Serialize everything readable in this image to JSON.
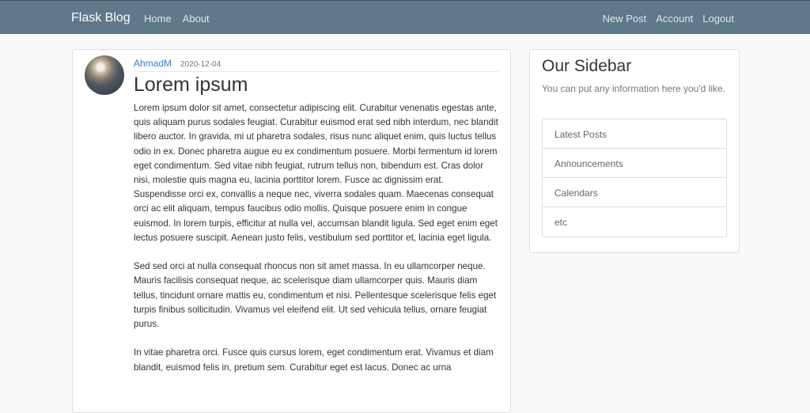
{
  "navbar": {
    "brand": "Flask Blog",
    "left_links": [
      "Home",
      "About"
    ],
    "right_links": [
      "New Post",
      "Account",
      "Logout"
    ]
  },
  "post": {
    "avatar_icon": "user-avatar-icon",
    "author": "AhmadM",
    "date": "2020-12-04",
    "title": "Lorem ipsum",
    "paragraphs": [
      "Lorem ipsum dolor sit amet, consectetur adipiscing elit. Curabitur venenatis egestas ante, quis aliquam purus sodales feugiat. Curabitur euismod erat sed nibh interdum, nec blandit libero auctor. In gravida, mi ut pharetra sodales, risus nunc aliquet enim, quis luctus tellus odio in ex. Donec pharetra augue eu ex condimentum posuere. Morbi fermentum id lorem eget condimentum. Sed vitae nibh feugiat, rutrum tellus non, bibendum est. Cras dolor nisi, molestie quis magna eu, lacinia porttitor lorem. Fusce ac dignissim erat. Suspendisse orci ex, convallis a neque nec, viverra sodales quam. Maecenas consequat orci ac elit aliquam, tempus faucibus odio mollis. Quisque posuere enim in congue euismod. In lorem turpis, efficitur at nulla vel, accumsan blandit ligula. Sed eget enim eget lectus posuere suscipit. Aenean justo felis, vestibulum sed porttitor et, lacinia eget ligula.",
      "Sed sed orci at nulla consequat rhoncus non sit amet massa. In eu ullamcorper neque. Mauris facilisis consequat neque, ac scelerisque diam ullamcorper quis. Mauris diam tellus, tincidunt ornare mattis eu, condimentum et nisi. Pellentesque scelerisque felis eget turpis finibus sollicitudin. Vivamus vel eleifend elit. Ut sed vehicula tellus, ornare feugiat purus.",
      "In vitae pharetra orci. Fusce quis cursus lorem, eget condimentum erat. Vivamus et diam blandit, euismod felis in, pretium sem. Curabitur eget est lacus. Donec ac urna"
    ]
  },
  "sidebar": {
    "title": "Our Sidebar",
    "text": "You can put any information here you'd like.",
    "items": [
      "Latest Posts",
      "Announcements",
      "Calendars",
      "etc"
    ]
  },
  "colors": {
    "navbar": "#5f788a",
    "link": "#2f7ed6",
    "background": "#fafafa"
  }
}
